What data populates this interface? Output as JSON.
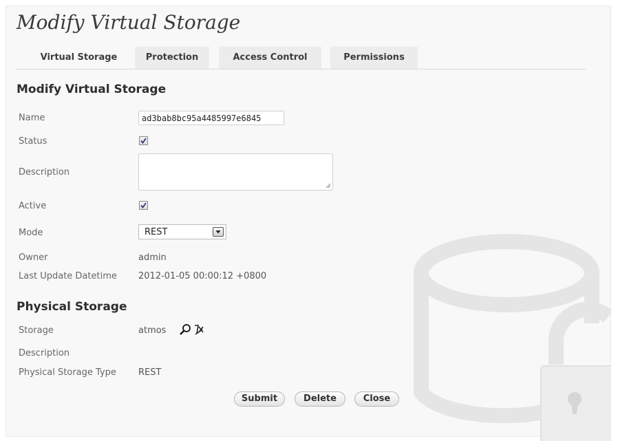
{
  "page": {
    "title": "Modify Virtual Storage"
  },
  "tabs": [
    {
      "label": "Virtual Storage",
      "active": true
    },
    {
      "label": "Protection",
      "active": false
    },
    {
      "label": "Access Control",
      "active": false
    },
    {
      "label": "Permissions",
      "active": false
    }
  ],
  "virtual_storage": {
    "heading": "Modify Virtual Storage",
    "name": {
      "label": "Name",
      "value": "ad3bab8bc95a4485997e6845"
    },
    "status": {
      "label": "Status",
      "checked": true
    },
    "description": {
      "label": "Description",
      "value": ""
    },
    "active": {
      "label": "Active",
      "checked": true
    },
    "mode": {
      "label": "Mode",
      "selected": "REST"
    },
    "owner": {
      "label": "Owner",
      "value": "admin"
    },
    "last_update": {
      "label": "Last Update Datetime",
      "value": "2012-01-05 00:00:12 +0800"
    }
  },
  "physical_storage": {
    "heading": "Physical Storage",
    "storage": {
      "label": "Storage",
      "value": "atmos",
      "icons": [
        "magnifier-icon",
        "clear-icon"
      ]
    },
    "description": {
      "label": "Description",
      "value": ""
    },
    "type": {
      "label": "Physical Storage Type",
      "value": "REST"
    }
  },
  "buttons": {
    "submit": "Submit",
    "delete": "Delete",
    "close": "Close"
  },
  "colors": {
    "panel_bg": "#f8f8f8",
    "tab_bg": "#ececec",
    "watermark": "#e6e6e6"
  }
}
